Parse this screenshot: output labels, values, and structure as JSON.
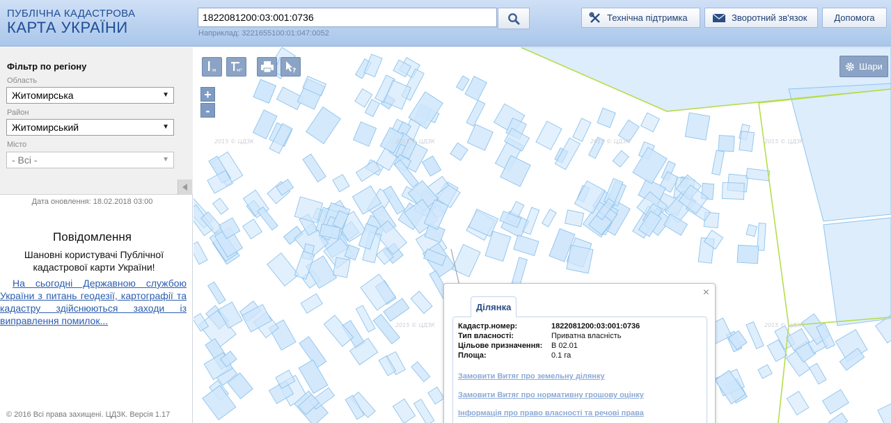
{
  "header": {
    "logo_line1": "ПУБЛІЧНА КАДАСТРОВА",
    "logo_line2": "КАРТА УКРАЇНИ",
    "search_value": "1822081200:03:001:0736",
    "search_hint": "Наприклад: 3221655100:01:047:0052",
    "search_icon": "search-icon",
    "buttons": {
      "support": "Технічна підтримка",
      "feedback": "Зворотний зв'язок",
      "help": "Допомога"
    }
  },
  "sidebar": {
    "filter_title": "Фільтр по регіону",
    "region_label": "Область",
    "region_value": "Житомирська",
    "district_label": "Район",
    "district_value": "Житомирський",
    "city_label": "Місто",
    "city_value": "- Всі -",
    "update_date": "Дата оновлення: 18.02.2018 03:00",
    "message_title": "Повідомлення",
    "message_text": "Шановні користувачі Публічної кадастрової карти України!",
    "message_link": "На сьогодні Державною службою України з питань геодезії, картографії та кадастру здійснюються заходи із виправлення помилок...",
    "copyright": "© 2016 Всі права захищені. ЦДЗК. Версія 1.17"
  },
  "map": {
    "layers_label": "Шари",
    "watermark": "2015 © ЦДЗК",
    "colors": {
      "parcel_fill": "#cfe6fb",
      "parcel_stroke": "#8ec3ec",
      "boundary": "#b6dd4a"
    }
  },
  "popup": {
    "tab": "Ділянка",
    "close": "×",
    "rows": [
      {
        "key": "Кадастр.номер:",
        "value": "1822081200:03:001:0736",
        "bold": true
      },
      {
        "key": "Тип власності:",
        "value": "Приватна власність",
        "bold": false
      },
      {
        "key": "Цільове призначення:",
        "value": "В 02.01",
        "bold": false
      },
      {
        "key": "Площа:",
        "value": "0.1 га",
        "bold": false
      }
    ],
    "links": [
      "Замовити Витяг про земельну ділянку",
      "Замовити Витяг про нормативну грошову оцінку",
      "Інформація про право власності та речові права"
    ]
  }
}
